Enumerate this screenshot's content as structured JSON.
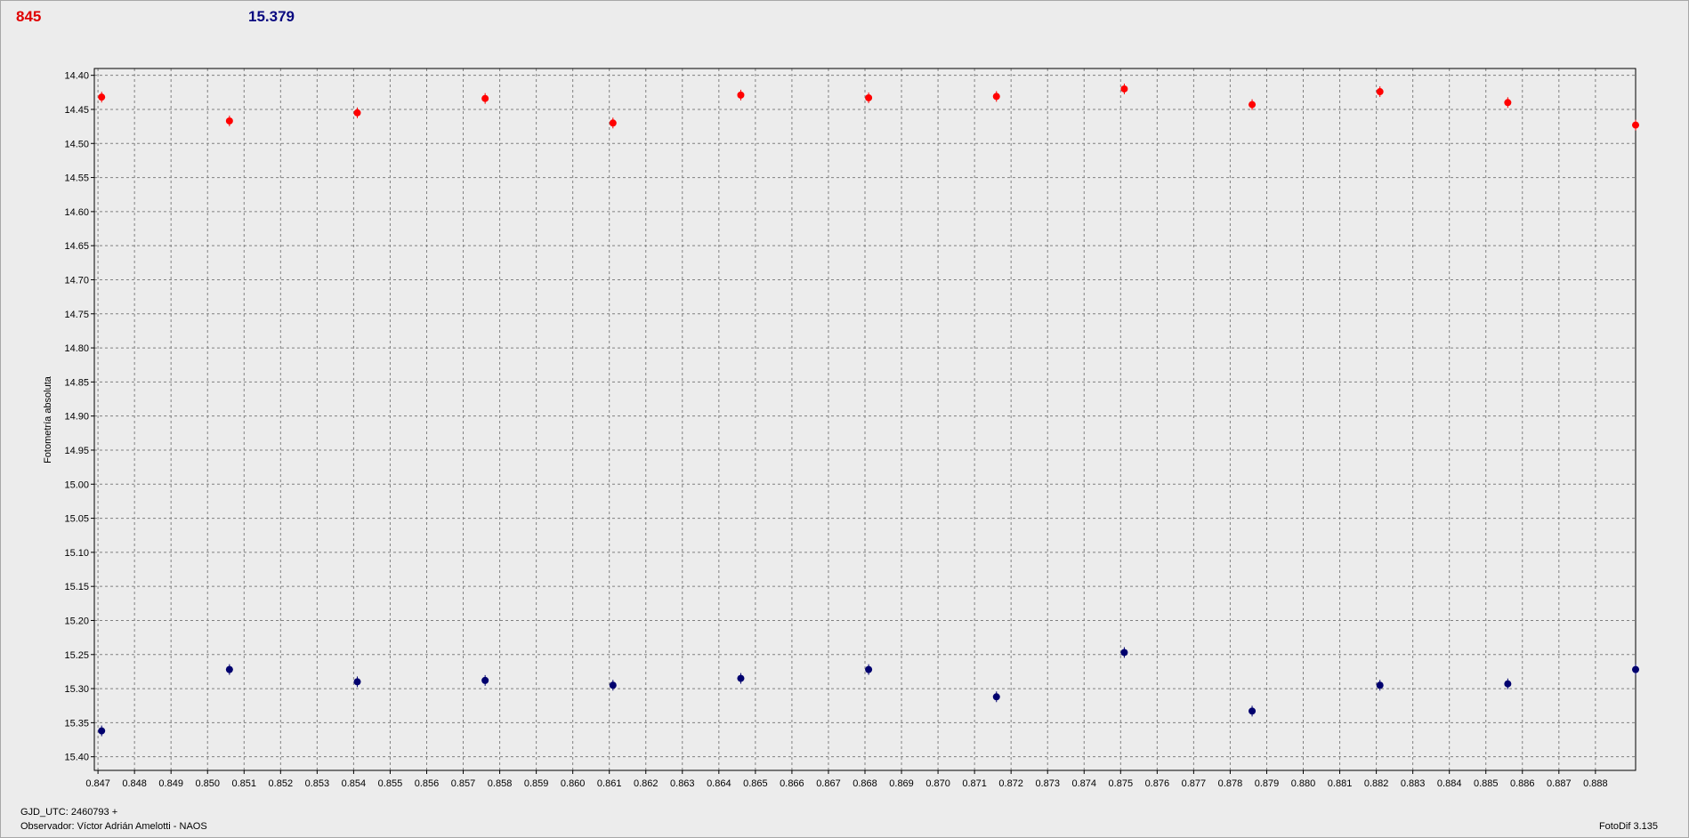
{
  "header": {
    "star_label": "845",
    "comp_value": "15.379"
  },
  "footer": {
    "gjd": "GJD_UTC: 2460793 +",
    "observer": "Observador: Víctor Adrián Amelotti - NAOS",
    "version": "FotoDif 3.135"
  },
  "colors": {
    "series_red": "#ff0000",
    "series_blue": "#00006e",
    "grid": "#808080",
    "background": "#ececec"
  },
  "chart_data": {
    "type": "scatter",
    "title": "",
    "xlabel": "",
    "ylabel": "Fotometría absoluta",
    "xlim": [
      0.8469,
      0.8891
    ],
    "ylim": [
      15.42,
      14.39
    ],
    "y_inverted": true,
    "grid": true,
    "x_ticks": [
      "0.847",
      "0.848",
      "0.849",
      "0.850",
      "0.851",
      "0.852",
      "0.853",
      "0.854",
      "0.855",
      "0.856",
      "0.857",
      "0.858",
      "0.859",
      "0.860",
      "0.861",
      "0.862",
      "0.863",
      "0.864",
      "0.865",
      "0.866",
      "0.867",
      "0.868",
      "0.869",
      "0.870",
      "0.871",
      "0.872",
      "0.873",
      "0.874",
      "0.875",
      "0.876",
      "0.877",
      "0.878",
      "0.879",
      "0.880",
      "0.881",
      "0.882",
      "0.883",
      "0.884",
      "0.885",
      "0.886",
      "0.887",
      "0.888"
    ],
    "y_ticks": [
      "14.40",
      "14.45",
      "14.50",
      "14.55",
      "14.60",
      "14.65",
      "14.70",
      "14.75",
      "14.80",
      "14.85",
      "14.90",
      "14.95",
      "15.00",
      "15.05",
      "15.10",
      "15.15",
      "15.20",
      "15.25",
      "15.30",
      "15.35",
      "15.40"
    ],
    "series": [
      {
        "color": "#ff0000",
        "x": [
          0.8471,
          0.8506,
          0.8541,
          0.8576,
          0.8611,
          0.8646,
          0.8681,
          0.8716,
          0.8751,
          0.8786,
          0.8821,
          0.8856,
          0.8891
        ],
        "y": [
          14.432,
          14.467,
          14.455,
          14.434,
          14.47,
          14.429,
          14.433,
          14.431,
          14.42,
          14.443,
          14.424,
          14.44,
          14.473
        ]
      },
      {
        "color": "#00006e",
        "x": [
          0.8471,
          0.8506,
          0.8541,
          0.8576,
          0.8611,
          0.8646,
          0.8681,
          0.8716,
          0.8751,
          0.8786,
          0.8821,
          0.8856,
          0.8891
        ],
        "y": [
          15.362,
          15.272,
          15.29,
          15.288,
          15.295,
          15.285,
          15.272,
          15.312,
          15.247,
          15.333,
          15.295,
          15.293,
          15.272
        ]
      }
    ]
  }
}
